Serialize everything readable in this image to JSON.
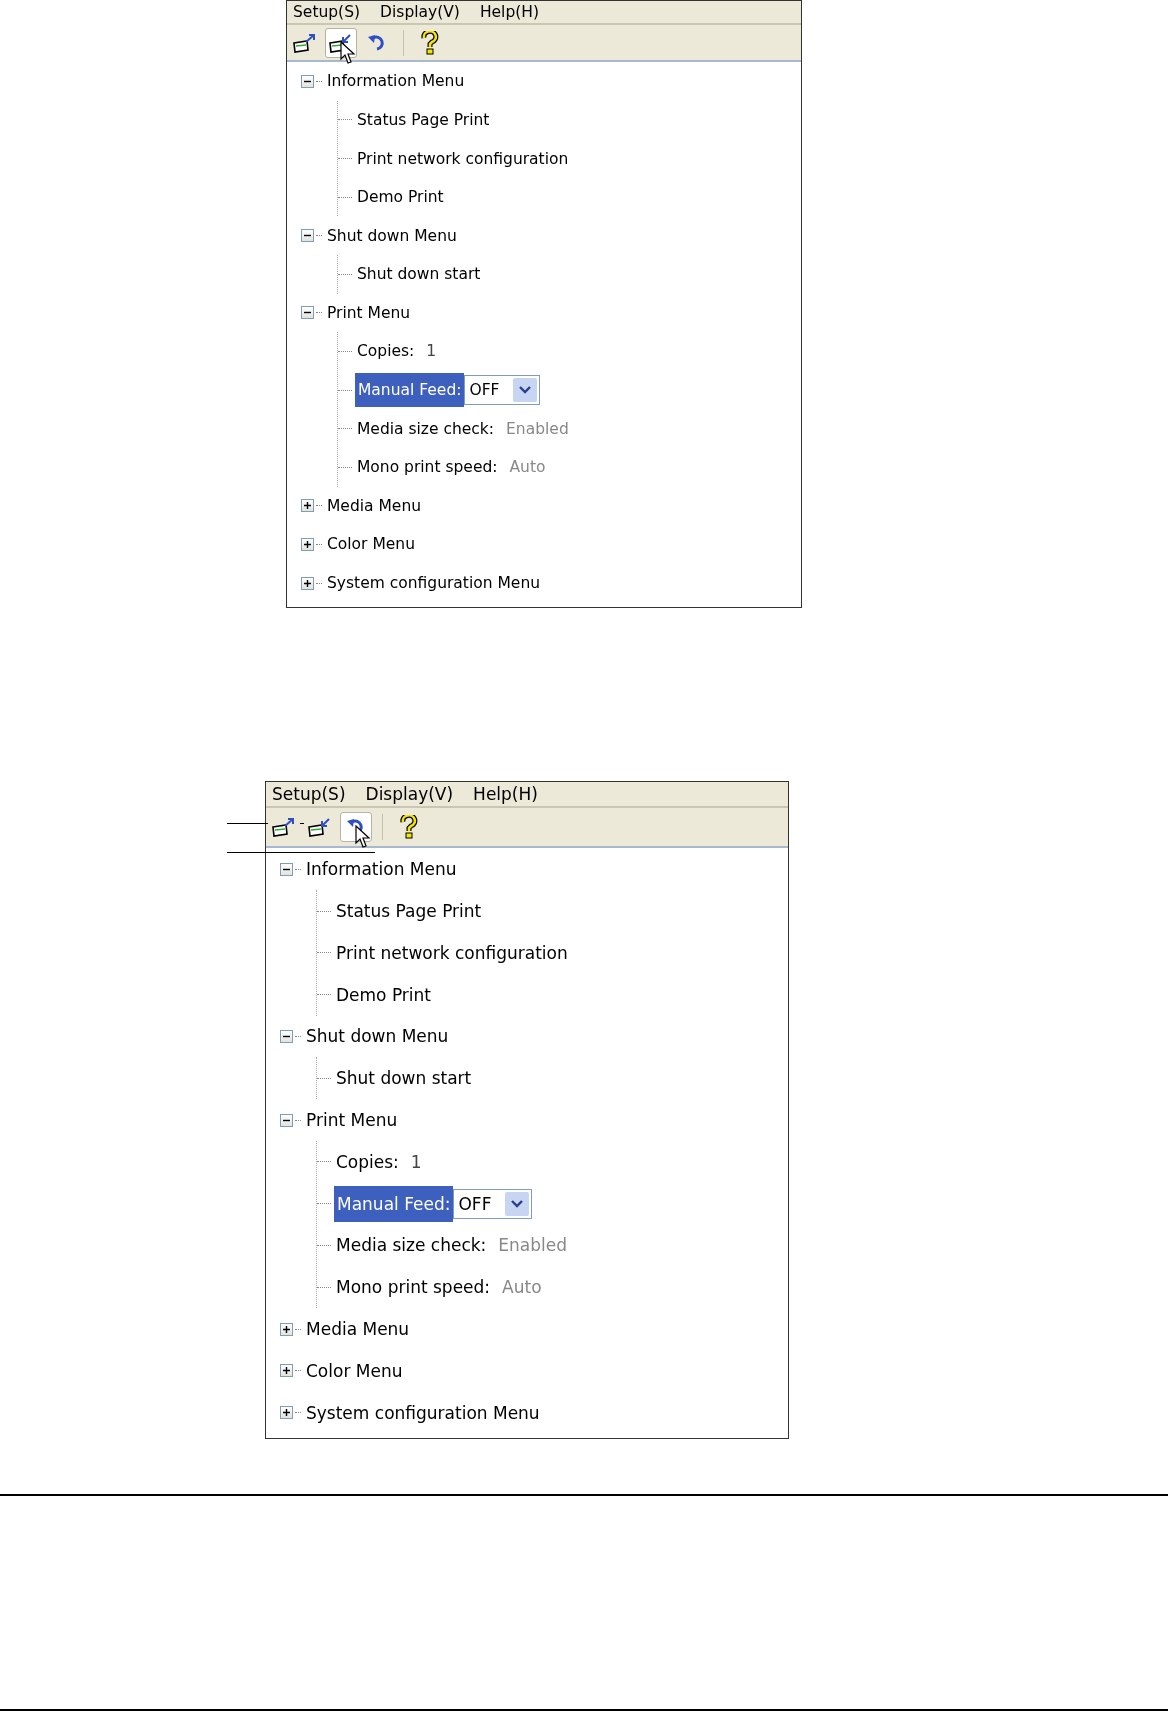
{
  "screenshots": [
    {
      "menu": [
        "Setup(S)",
        "Display(V)",
        "Help(H)"
      ],
      "toolbar": [
        {
          "kind": "upload",
          "selected": false
        },
        {
          "kind": "download",
          "selected": true
        },
        {
          "kind": "undo",
          "selected": false
        },
        {
          "kind": "separator"
        },
        {
          "kind": "help",
          "selected": false
        }
      ],
      "tree": [
        {
          "label": "Information Menu",
          "expanded": true,
          "children": [
            {
              "kind": "action",
              "label": "Status Page Print"
            },
            {
              "kind": "action",
              "label": "Print network configuration"
            },
            {
              "kind": "action",
              "label": "Demo Print"
            }
          ]
        },
        {
          "label": "Shut down Menu",
          "expanded": true,
          "children": [
            {
              "kind": "action",
              "label": "Shut down start"
            }
          ]
        },
        {
          "label": "Print Menu",
          "expanded": true,
          "children": [
            {
              "kind": "value",
              "label": "Copies:",
              "value": "1",
              "disabled": false
            },
            {
              "kind": "select",
              "label": "Manual Feed:",
              "value": "OFF",
              "selected": true
            },
            {
              "kind": "value",
              "label": "Media size check:",
              "value": "Enabled",
              "disabled": true
            },
            {
              "kind": "value",
              "label": "Mono print speed:",
              "value": "Auto",
              "disabled": true
            }
          ]
        },
        {
          "label": "Media Menu",
          "expanded": false
        },
        {
          "label": "Color Menu",
          "expanded": false
        },
        {
          "label": "System configuration Menu",
          "expanded": false
        }
      ]
    },
    {
      "menu": [
        "Setup(S)",
        "Display(V)",
        "Help(H)"
      ],
      "toolbar": [
        {
          "kind": "upload",
          "selected": false
        },
        {
          "kind": "download",
          "selected": false
        },
        {
          "kind": "undo",
          "selected": true
        },
        {
          "kind": "separator"
        },
        {
          "kind": "help",
          "selected": false
        }
      ],
      "tree": [
        {
          "label": "Information Menu",
          "expanded": true,
          "children": [
            {
              "kind": "action",
              "label": "Status Page Print"
            },
            {
              "kind": "action",
              "label": "Print network configuration"
            },
            {
              "kind": "action",
              "label": "Demo Print"
            }
          ]
        },
        {
          "label": "Shut down Menu",
          "expanded": true,
          "children": [
            {
              "kind": "action",
              "label": "Shut down start"
            }
          ]
        },
        {
          "label": "Print Menu",
          "expanded": true,
          "children": [
            {
              "kind": "value",
              "label": "Copies:",
              "value": "1",
              "disabled": false
            },
            {
              "kind": "select",
              "label": "Manual Feed:",
              "value": "OFF",
              "selected": true
            },
            {
              "kind": "value",
              "label": "Media size check:",
              "value": "Enabled",
              "disabled": true
            },
            {
              "kind": "value",
              "label": "Mono print speed:",
              "value": "Auto",
              "disabled": true
            }
          ]
        },
        {
          "label": "Media Menu",
          "expanded": false
        },
        {
          "label": "Color Menu",
          "expanded": false
        },
        {
          "label": "System configuration Menu",
          "expanded": false
        }
      ]
    }
  ]
}
